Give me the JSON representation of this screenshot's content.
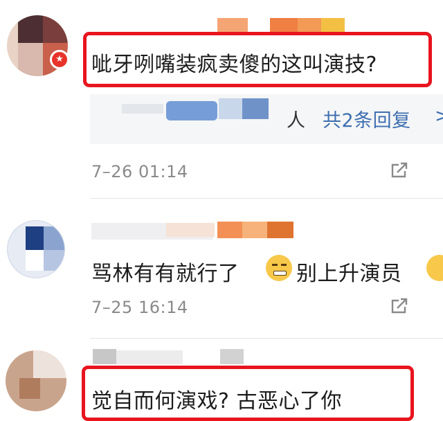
{
  "comments": [
    {
      "text": "呲牙咧嘴装疯卖傻的这叫演技?",
      "timestamp": "7–26 01:14",
      "replies_link": "共2条回复",
      "reply_preview_tail": "人",
      "reply_chevron": ">",
      "avatar_badge_icon": "star-badge-icon"
    },
    {
      "text_a": "骂林有有就行了",
      "text_b": "别上升演员",
      "timestamp": "7–25 16:14",
      "emoji_icon": "grinning-emoji-icon"
    },
    {
      "text": "觉自而何演戏? 古恶心了你"
    }
  ],
  "colors": {
    "highlight_border": "#e8141e",
    "link": "#3d6fb0",
    "timestamp": "#8a8a8a",
    "text": "#1c1c1c"
  }
}
